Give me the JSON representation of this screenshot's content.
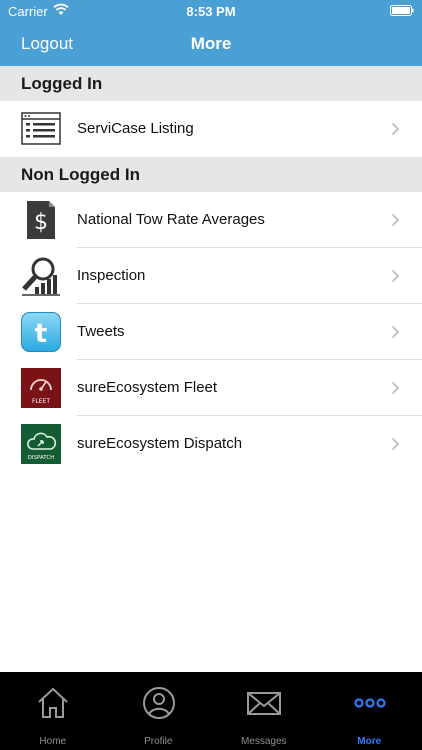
{
  "status": {
    "carrier": "Carrier",
    "time": "8:53 PM"
  },
  "nav": {
    "logout": "Logout",
    "title": "More"
  },
  "sections": {
    "logged_in": {
      "header": "Logged In",
      "items": [
        {
          "label": "ServiCase Listing",
          "icon": "listing-icon"
        }
      ]
    },
    "non_logged_in": {
      "header": "Non Logged In",
      "items": [
        {
          "label": "National Tow Rate Averages",
          "icon": "dollar-document-icon"
        },
        {
          "label": "Inspection",
          "icon": "magnifier-chart-icon"
        },
        {
          "label": "Tweets",
          "icon": "twitter-icon"
        },
        {
          "label": "sureEcosystem Fleet",
          "icon": "fleet-gauge-icon",
          "badge": "FLEET"
        },
        {
          "label": "sureEcosystem Dispatch",
          "icon": "dispatch-cloud-icon",
          "badge": "DISPATCH"
        }
      ]
    }
  },
  "tabs": [
    {
      "label": "Home",
      "icon": "home-icon"
    },
    {
      "label": "Profile",
      "icon": "profile-icon"
    },
    {
      "label": "Messages",
      "icon": "envelope-icon"
    },
    {
      "label": "More",
      "icon": "more-dots-icon",
      "active": true
    }
  ],
  "colors": {
    "accent": "#4a9fd4",
    "active_tab": "#2f7bff"
  }
}
